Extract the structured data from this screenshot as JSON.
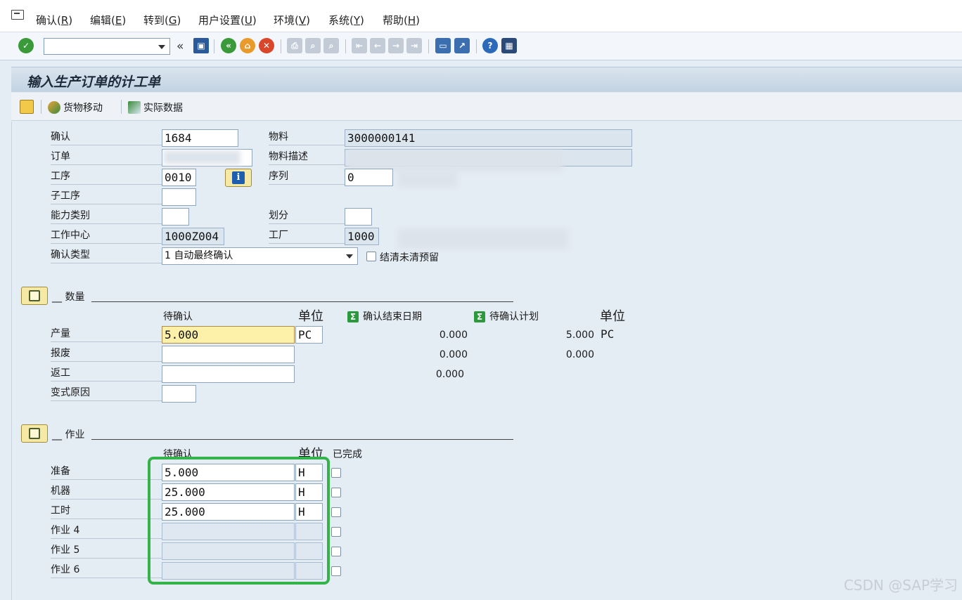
{
  "menu": {
    "items": [
      {
        "label": "确认(",
        "key": "R",
        "end": ")"
      },
      {
        "label": "编辑(",
        "key": "E",
        "end": ")"
      },
      {
        "label": "转到(",
        "key": "G",
        "end": ")"
      },
      {
        "label": "用户设置(",
        "key": "U",
        "end": ")"
      },
      {
        "label": "环境(",
        "key": "V",
        "end": ")"
      },
      {
        "label": "系统(",
        "key": "Y",
        "end": ")"
      },
      {
        "label": "帮助(",
        "key": "H",
        "end": ")"
      }
    ]
  },
  "toolbar": {
    "command_value": "",
    "back_symbol": "«"
  },
  "title": "输入生产订单的计工单",
  "app_toolbar": {
    "goods_movement": "货物移动",
    "actual_data": "实际数据"
  },
  "header_fields": {
    "confirmation": {
      "label": "确认",
      "value": "1684"
    },
    "order": {
      "label": "订单",
      "value": ""
    },
    "operation": {
      "label": "工序",
      "value": "0010"
    },
    "sub_operation": {
      "label": "子工序",
      "value": ""
    },
    "capacity_category": {
      "label": "能力类别",
      "value": ""
    },
    "work_center": {
      "label": "工作中心",
      "value": "1000Z004"
    },
    "confirmation_type": {
      "label": "确认类型",
      "value": "1 自动最终确认"
    },
    "material": {
      "label": "物料",
      "value": "3000000141"
    },
    "material_desc": {
      "label": "物料描述",
      "value": ""
    },
    "sequence": {
      "label": "序列",
      "value": "0"
    },
    "split": {
      "label": "划分",
      "value": ""
    },
    "plant": {
      "label": "工厂",
      "value": "1000"
    },
    "clear_reservations": {
      "label": "结清未清预留",
      "checked": false
    }
  },
  "quantity_section": {
    "title": "__ 数量",
    "col_to_confirm": "待确认",
    "col_unit": "单位",
    "col_confirmed_end": "确认结束日期",
    "col_planned": "待确认计划",
    "col_unit2": "单位",
    "rows": [
      {
        "label": "产量",
        "to_confirm": "5.000",
        "unit": "PC",
        "confirmed": "0.000",
        "planned": "5.000",
        "unit2": "PC"
      },
      {
        "label": "报废",
        "to_confirm": "",
        "unit": "",
        "confirmed": "0.000",
        "planned": "0.000",
        "unit2": ""
      },
      {
        "label": "返工",
        "to_confirm": "",
        "unit": "",
        "confirmed": "0.000",
        "planned": "",
        "unit2": ""
      },
      {
        "label": "变式原因",
        "to_confirm": "",
        "unit": "",
        "confirmed": "",
        "planned": "",
        "unit2": ""
      }
    ]
  },
  "activity_section": {
    "title": "__ 作业",
    "col_to_confirm": "待确认",
    "col_unit": "单位",
    "col_done": "已完成",
    "rows": [
      {
        "label": "准备",
        "value": "5.000",
        "unit": "H"
      },
      {
        "label": "机器",
        "value": "25.000",
        "unit": "H"
      },
      {
        "label": "工时",
        "value": "25.000",
        "unit": "H"
      },
      {
        "label": "作业 4",
        "value": "",
        "unit": ""
      },
      {
        "label": "作业 5",
        "value": "",
        "unit": ""
      },
      {
        "label": "作业 6",
        "value": "",
        "unit": ""
      }
    ]
  },
  "watermark": "CSDN @SAP学习",
  "colors": {
    "highlight_box": "#34b34a",
    "active_field": "#fdf0a8"
  }
}
